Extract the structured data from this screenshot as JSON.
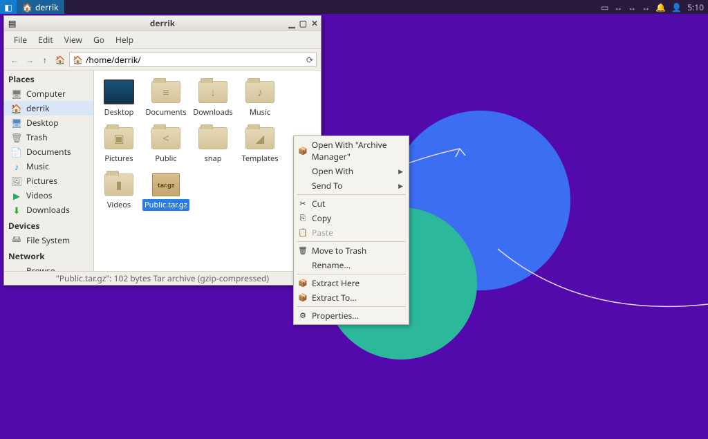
{
  "panel": {
    "task_label": "derrik",
    "time": "5:10"
  },
  "window": {
    "title": "derrik",
    "menubar": [
      "File",
      "Edit",
      "View",
      "Go",
      "Help"
    ],
    "path": "/home/derrik/",
    "statusbar": "\"Public.tar.gz\": 102 bytes Tar archive (gzip-compressed)"
  },
  "sidebar": {
    "places_heading": "Places",
    "devices_heading": "Devices",
    "network_heading": "Network",
    "places": [
      {
        "label": "Computer",
        "icon": "🖥",
        "cls": "ic-computer"
      },
      {
        "label": "derrik",
        "icon": "🏠",
        "cls": "ic-home",
        "selected": true
      },
      {
        "label": "Desktop",
        "icon": "🖥",
        "cls": "ic-desktop"
      },
      {
        "label": "Trash",
        "icon": "🗑",
        "cls": "ic-trash"
      },
      {
        "label": "Documents",
        "icon": "📄",
        "cls": "ic-doc"
      },
      {
        "label": "Music",
        "icon": "♪",
        "cls": "ic-music"
      },
      {
        "label": "Pictures",
        "icon": "🖼",
        "cls": "ic-pic"
      },
      {
        "label": "Videos",
        "icon": "▶",
        "cls": "ic-video"
      },
      {
        "label": "Downloads",
        "icon": "⬇",
        "cls": "ic-dl"
      }
    ],
    "devices": [
      {
        "label": "File System",
        "icon": "🖴",
        "cls": "ic-fs"
      }
    ],
    "network": [
      {
        "label": "Browse Network",
        "icon": "📶",
        "cls": "ic-net"
      }
    ]
  },
  "files": [
    {
      "label": "Desktop",
      "type": "desktop"
    },
    {
      "label": "Documents",
      "type": "folder",
      "emblem": "≡"
    },
    {
      "label": "Downloads",
      "type": "folder",
      "emblem": "↓"
    },
    {
      "label": "Music",
      "type": "folder",
      "emblem": "♪"
    },
    {
      "label": "Pictures",
      "type": "folder",
      "emblem": "▣"
    },
    {
      "label": "Public",
      "type": "folder",
      "emblem": "<"
    },
    {
      "label": "snap",
      "type": "folder",
      "emblem": ""
    },
    {
      "label": "Templates",
      "type": "folder",
      "emblem": "◢"
    },
    {
      "label": "Videos",
      "type": "folder",
      "emblem": "▮"
    },
    {
      "label": "Public.tar.gz",
      "type": "archive",
      "badge": "tar.gz",
      "selected": true
    }
  ],
  "context_menu": [
    {
      "label": "Open With \"Archive Manager\"",
      "icon": "📦"
    },
    {
      "label": "Open With",
      "submenu": true
    },
    {
      "label": "Send To",
      "submenu": true
    },
    {
      "sep": true
    },
    {
      "label": "Cut",
      "icon": "✂"
    },
    {
      "label": "Copy",
      "icon": "⎘"
    },
    {
      "label": "Paste",
      "icon": "📋",
      "disabled": true
    },
    {
      "sep": true
    },
    {
      "label": "Move to Trash",
      "icon": "🗑"
    },
    {
      "label": "Rename...",
      "disabled": false
    },
    {
      "sep": true
    },
    {
      "label": "Extract Here",
      "icon": "📦"
    },
    {
      "label": "Extract To...",
      "icon": "📦"
    },
    {
      "sep": true
    },
    {
      "label": "Properties...",
      "icon": "⚙"
    }
  ]
}
